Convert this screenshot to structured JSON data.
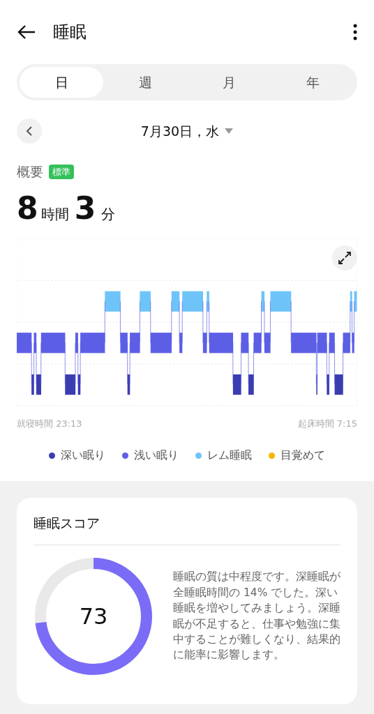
{
  "header": {
    "title": "睡眠"
  },
  "tabs": [
    {
      "label": "日",
      "selected": true
    },
    {
      "label": "週",
      "selected": false
    },
    {
      "label": "月",
      "selected": false
    },
    {
      "label": "年",
      "selected": false
    }
  ],
  "date": {
    "label": "7月30日，水"
  },
  "overview": {
    "label": "概要",
    "badge": "標準",
    "hours": "8",
    "hours_unit": "時間",
    "minutes": "3",
    "minutes_unit": "分"
  },
  "sleep_times": {
    "bedtime": "就寝時間 23:13",
    "wake": "起床時間 7:15"
  },
  "legend": [
    {
      "label": "深い眠り",
      "color": "#3a3db0"
    },
    {
      "label": "浅い眠り",
      "color": "#5c5fe6"
    },
    {
      "label": "レム睡眠",
      "color": "#6ec4f8"
    },
    {
      "label": "目覚めて",
      "color": "#f5b800"
    }
  ],
  "score_card": {
    "title": "睡眠スコア",
    "score": "73",
    "description": "睡眠の質は中程度です。深睡眠が全睡眠時間の 14% でした。深い睡眠を増やしてみましょう。深睡眠が不足すると、仕事や勉強に集中することが難しくなり、結果的に能率に影響します。"
  }
}
